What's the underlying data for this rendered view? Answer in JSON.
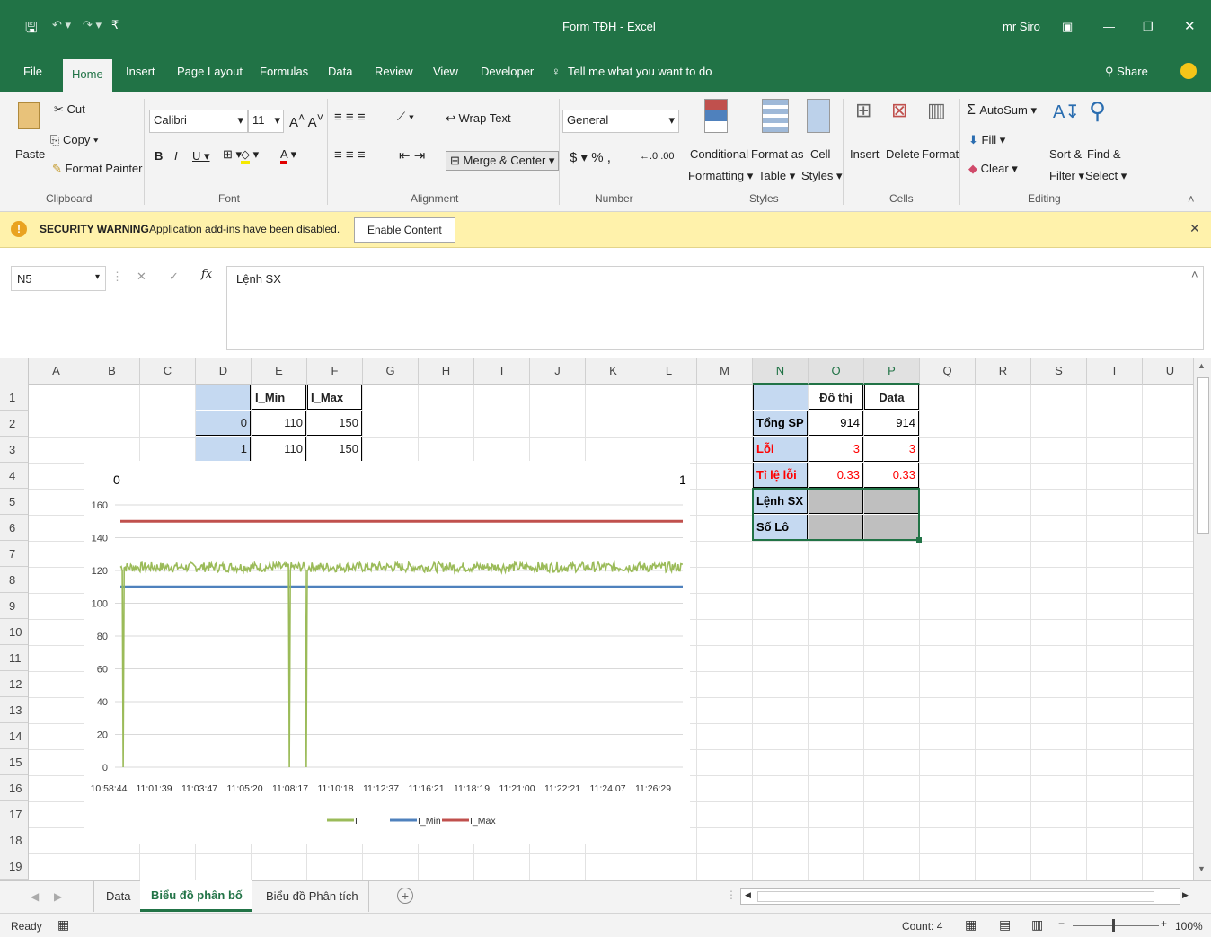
{
  "window": {
    "title": "Form TĐH  -  Excel",
    "user": "mr Siro"
  },
  "tabs": [
    "File",
    "Home",
    "Insert",
    "Page Layout",
    "Formulas",
    "Data",
    "Review",
    "View",
    "Developer"
  ],
  "tell_me": "Tell me what you want to do",
  "share": "Share",
  "ribbon": {
    "clipboard": {
      "paste": "Paste",
      "cut": "Cut",
      "copy": "Copy",
      "format_painter": "Format Painter",
      "label": "Clipboard"
    },
    "font": {
      "name": "Calibri",
      "size": "11",
      "label": "Font"
    },
    "alignment": {
      "wrap": "Wrap Text",
      "merge": "Merge & Center",
      "label": "Alignment"
    },
    "number": {
      "format": "General",
      "label": "Number"
    },
    "styles": {
      "conditional": "Conditional",
      "formatting": "Formatting",
      "format_as": "Format as",
      "table": "Table",
      "cell": "Cell",
      "cell_styles": "Styles",
      "label": "Styles"
    },
    "cells": {
      "insert": "Insert",
      "delete": "Delete",
      "format": "Format",
      "label": "Cells"
    },
    "editing": {
      "autosum": "AutoSum",
      "fill": "Fill",
      "clear": "Clear",
      "sort": "Sort &",
      "filter": "Filter",
      "find": "Find &",
      "select": "Select",
      "label": "Editing"
    }
  },
  "warning": {
    "title": "SECURITY WARNING",
    "message": "Application add-ins have been disabled.",
    "button": "Enable Content"
  },
  "formula": {
    "namebox": "N5",
    "content": "Lệnh SX"
  },
  "columns": [
    "A",
    "B",
    "C",
    "D",
    "E",
    "F",
    "G",
    "H",
    "I",
    "J",
    "K",
    "L",
    "M",
    "N",
    "O",
    "P",
    "Q",
    "R",
    "S",
    "T",
    "U"
  ],
  "rows": [
    "1",
    "2",
    "3",
    "4",
    "5",
    "6",
    "7",
    "8",
    "9",
    "10",
    "11",
    "12",
    "13",
    "14",
    "15",
    "16",
    "17",
    "18",
    "19"
  ],
  "table_left": {
    "headers": [
      "I_Min",
      "I_Max"
    ],
    "rows": [
      [
        "0",
        "110",
        "150"
      ],
      [
        "1",
        "110",
        "150"
      ]
    ]
  },
  "table_right": {
    "headers": [
      "Đồ thị",
      "Data"
    ],
    "rows": [
      {
        "label": "Tổng SP",
        "a": "914",
        "b": "914"
      },
      {
        "label": "Lỗi",
        "a": "3",
        "b": "3"
      },
      {
        "label": "Tỉ lệ lỗi",
        "a": "0.33",
        "b": "0.33"
      },
      {
        "label": "Lệnh SX",
        "a": "",
        "b": ""
      },
      {
        "label": "Số Lô",
        "a": "",
        "b": ""
      }
    ]
  },
  "chart_data": {
    "type": "line",
    "title": "",
    "top_labels": [
      "0",
      "1"
    ],
    "ylim": [
      0,
      160
    ],
    "yticks": [
      "0",
      "20",
      "40",
      "60",
      "80",
      "100",
      "120",
      "140",
      "160"
    ],
    "categories": [
      "10:58:44",
      "11:01:39",
      "11:03:47",
      "11:05:20",
      "11:08:17",
      "11:10:18",
      "11:12:37",
      "11:16:21",
      "11:18:19",
      "11:21:00",
      "11:22:21",
      "11:24:07",
      "11:26:29"
    ],
    "series": [
      {
        "name": "I",
        "color": "#9bbb59",
        "baseline": 122,
        "noise": 3,
        "drops": [
          0.005,
          0.3,
          0.33
        ]
      },
      {
        "name": "I_Min",
        "color": "#4f81bd",
        "value": 110
      },
      {
        "name": "I_Max",
        "color": "#c0504d",
        "value": 150
      }
    ]
  },
  "sheets": [
    "Data",
    "Biểu đồ phân bố",
    "Biểu đồ Phân tích"
  ],
  "status": {
    "ready": "Ready",
    "count": "Count: 4",
    "zoom": "100%"
  }
}
